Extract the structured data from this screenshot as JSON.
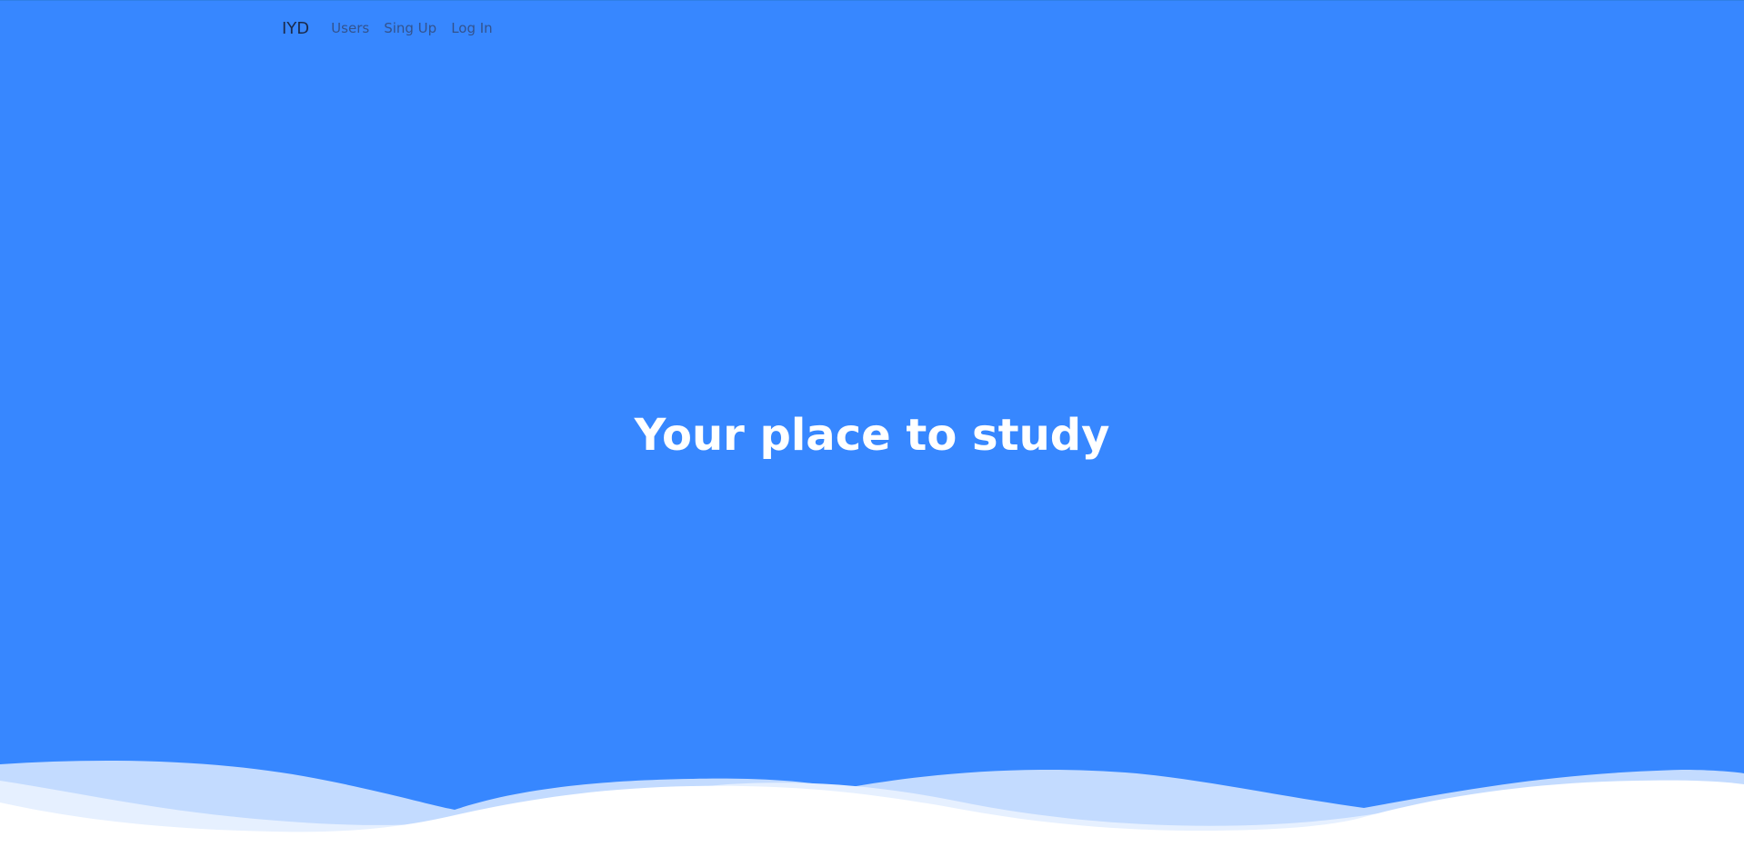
{
  "navbar": {
    "brand": "IYD",
    "links": [
      {
        "label": "Users"
      },
      {
        "label": "Sing Up"
      },
      {
        "label": "Log In"
      }
    ]
  },
  "hero": {
    "headline": "Your place to study"
  },
  "colors": {
    "hero_background": "#3787ff",
    "headline_text": "#ffffff",
    "wave_light": "#c3dbff",
    "wave_lighter": "#e6f0ff",
    "wave_white": "#ffffff"
  }
}
